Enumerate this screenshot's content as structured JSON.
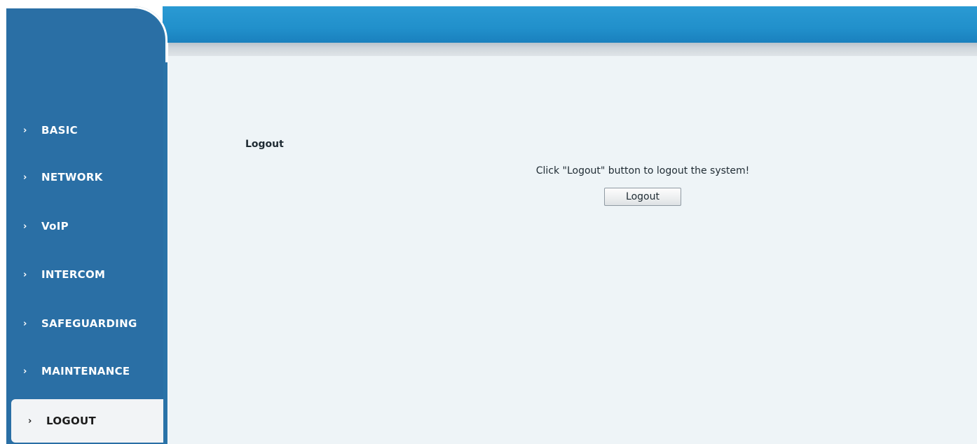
{
  "sidebar": {
    "items": [
      {
        "label": "BASIC",
        "icon": "chevron-right-icon"
      },
      {
        "label": "NETWORK",
        "icon": "chevron-right-icon"
      },
      {
        "label": "VoIP",
        "icon": "chevron-right-icon"
      },
      {
        "label": "INTERCOM",
        "icon": "chevron-right-icon"
      },
      {
        "label": "SAFEGUARDING",
        "icon": "chevron-right-icon"
      },
      {
        "label": "MAINTENANCE",
        "icon": "chevron-right-icon"
      },
      {
        "label": "LOGOUT",
        "icon": "chevron-right-icon",
        "active": true
      }
    ],
    "chevron_glyph": "›"
  },
  "main": {
    "section_title": "Logout",
    "message": "Click \"Logout\" button to logout the system!",
    "logout_button_label": "Logout"
  },
  "colors": {
    "banner": "#2190cb",
    "sidebar": "#2a6fa5",
    "content_bg": "#eef4f7",
    "active_item_bg": "#f2f4f6"
  }
}
